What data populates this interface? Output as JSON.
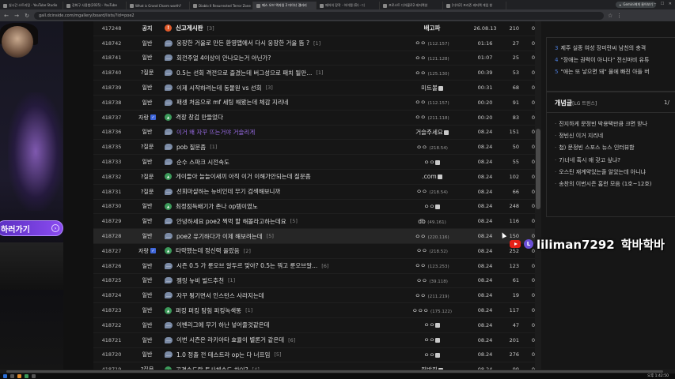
{
  "browser": {
    "tabs": [
      {
        "label": "실시간 스트리밍 - YouTube Studio",
        "active": false
      },
      {
        "label": "강화구 사용법(2025) - YouTube",
        "active": false
      },
      {
        "label": "What is Grand Charm worth?",
        "active": false
      },
      {
        "label": "Diablo II Resurrected Terror Zone",
        "active": false
      },
      {
        "label": "패스 오브 엑자일 2 마이너 갤러리",
        "active": true
      },
      {
        "label": "패어의 장작 - 아이템 (D) - 디",
        "active": false
      },
      {
        "label": "프로스트 디아블로2 레저렉션",
        "active": false
      },
      {
        "label": "[디아2] 프리즌 레저렉 게임 창",
        "active": false
      }
    ],
    "gemini_pill": "Gemini에게 물어보기",
    "url": "gall.dcinside.com/mgallery/board/lists/?id=poe2"
  },
  "poster": {
    "cta_label": "하러가기"
  },
  "posts": [
    {
      "no": "417248",
      "cat": "공지",
      "badge": false,
      "icon": "notice",
      "title": "신고게시판",
      "count": "[3]",
      "writer": "배고파",
      "ip": "",
      "wbadge": false,
      "date": "26.08.13",
      "views": "210",
      "rec": "0",
      "highlight": false,
      "bold": true
    },
    {
      "no": "418742",
      "cat": "일반",
      "badge": false,
      "icon": "bubble",
      "title": "웅장한 거울로 만든 환영맵에서 다시 웅장한 거울 뜸 ?",
      "count": "[1]",
      "writer": "ㅇㅇ",
      "ip": "(112.157)",
      "wbadge": false,
      "date": "01:16",
      "views": "27",
      "rec": "0",
      "highlight": false,
      "bold": false
    },
    {
      "no": "418741",
      "cat": "일반",
      "badge": false,
      "icon": "bubble",
      "title": "회전주얼 4이상이 안나오는거 아닌가?",
      "count": "",
      "writer": "ㅇㅇ",
      "ip": "(121.128)",
      "wbadge": false,
      "date": "01:07",
      "views": "25",
      "rec": "0",
      "highlight": false,
      "bold": false
    },
    {
      "no": "418740",
      "cat": "?질문",
      "badge": false,
      "icon": "bubble",
      "title": "0.5는 선회 격전으로 즐겼는데 버그성으로 패치 될만...",
      "count": "[1]",
      "writer": "ㅇㅇ",
      "ip": "(125.130)",
      "wbadge": false,
      "date": "00:39",
      "views": "53",
      "rec": "0",
      "highlight": false,
      "bold": false
    },
    {
      "no": "418739",
      "cat": "일반",
      "badge": false,
      "icon": "bubble",
      "title": "이제 시작하려는데 동물원 vs 선회",
      "count": "[3]",
      "writer": "미트볼",
      "ip": "",
      "wbadge": true,
      "date": "00:31",
      "views": "68",
      "rec": "0",
      "highlight": false,
      "bold": false
    },
    {
      "no": "418738",
      "cat": "일반",
      "badge": false,
      "icon": "bubble",
      "title": "패셍 처음으로 mf 세팅 해봤는데 체감 지리네",
      "count": "",
      "writer": "ㅇㅇ",
      "ip": "(112.157)",
      "wbadge": false,
      "date": "00:20",
      "views": "91",
      "rec": "0",
      "highlight": false,
      "bold": false
    },
    {
      "no": "418737",
      "cat": "자랑",
      "badge": true,
      "icon": "img",
      "title": "격장 창검 만들었다",
      "count": "",
      "writer": "ㅇㅇ",
      "ip": "(211.118)",
      "wbadge": false,
      "date": "00:20",
      "views": "83",
      "rec": "0",
      "highlight": false,
      "bold": false
    },
    {
      "no": "418736",
      "cat": "일반",
      "badge": false,
      "icon": "bubble",
      "title": "이거 왜 자꾸 뜨는거야 거슬리게",
      "count": "",
      "writer": "거슬주세요",
      "ip": "",
      "wbadge": true,
      "date": "08.24",
      "views": "151",
      "rec": "0",
      "highlight": false,
      "bold": false,
      "visited": true
    },
    {
      "no": "418735",
      "cat": "?질문",
      "badge": false,
      "icon": "bubble",
      "title": "pob 질문좀",
      "count": "[1]",
      "writer": "ㅇㅇ",
      "ip": "(218.54)",
      "wbadge": false,
      "date": "08.24",
      "views": "50",
      "rec": "0",
      "highlight": false,
      "bold": false
    },
    {
      "no": "418733",
      "cat": "일반",
      "badge": false,
      "icon": "bubble",
      "title": "순수 스파크 시전속도",
      "count": "",
      "writer": "ㅇㅇ",
      "ip": "",
      "wbadge": true,
      "date": "08.24",
      "views": "55",
      "rec": "0",
      "highlight": false,
      "bold": false
    },
    {
      "no": "418732",
      "cat": "?질문",
      "badge": false,
      "icon": "img",
      "title": "게이들아 늘늘이새끼 아직 이거 이해가안되는데 질문좀",
      "count": "",
      "writer": ".com",
      "ip": "",
      "wbadge": true,
      "date": "08.24",
      "views": "102",
      "rec": "0",
      "highlight": false,
      "bold": false
    },
    {
      "no": "418731",
      "cat": "?질문",
      "badge": false,
      "icon": "bubble",
      "title": "선회마샬하는 뉴비인데 무기 검색해보니까",
      "count": "",
      "writer": "ㅇㅇ",
      "ip": "(218.54)",
      "wbadge": false,
      "date": "08.24",
      "views": "66",
      "rec": "0",
      "highlight": false,
      "bold": false
    },
    {
      "no": "418730",
      "cat": "일반",
      "badge": false,
      "icon": "img",
      "title": "최정점득배기가 존나 op템이였노",
      "count": "",
      "writer": "ㅇㅇ",
      "ip": "",
      "wbadge": true,
      "date": "08.24",
      "views": "248",
      "rec": "0",
      "highlight": false,
      "bold": false
    },
    {
      "no": "418729",
      "cat": "일반",
      "badge": false,
      "icon": "bubble",
      "title": "안녕하세요 poe2 찍먹 할 해볼라고하는데요",
      "count": "[5]",
      "writer": "db",
      "ip": "(49.161)",
      "wbadge": false,
      "date": "08.24",
      "views": "116",
      "rec": "0",
      "highlight": false,
      "bold": false
    },
    {
      "no": "418728",
      "cat": "일반",
      "badge": false,
      "icon": "bubble",
      "title": "poe2 유기하다가 이제 해보려는데",
      "count": "[5]",
      "writer": "ㅇㅇ",
      "ip": "(220.116)",
      "wbadge": false,
      "date": "08.24",
      "views": "150",
      "rec": "0",
      "highlight": true,
      "bold": false
    },
    {
      "no": "418727",
      "cat": "자랑",
      "badge": true,
      "icon": "img",
      "title": "타락했는데 정신력 올랐음",
      "count": "[2]",
      "writer": "ㅇㅇ",
      "ip": "(218.52)",
      "wbadge": false,
      "date": "08.24",
      "views": "252",
      "rec": "0",
      "highlight": false,
      "bold": false
    },
    {
      "no": "418726",
      "cat": "일반",
      "badge": false,
      "icon": "bubble",
      "title": "시즌 0.5 가 룬오브 알두르 맞아? 0.5는 뭐고 룬오브알...",
      "count": "[6]",
      "writer": "ㅇㅇ",
      "ip": "(123.253)",
      "wbadge": false,
      "date": "08.24",
      "views": "123",
      "rec": "0",
      "highlight": false,
      "bold": false
    },
    {
      "no": "418725",
      "cat": "일반",
      "badge": false,
      "icon": "bubble",
      "title": "젬링 뉴비 빌드추천",
      "count": "[1]",
      "writer": "ㅇㅇ",
      "ip": "(39.118)",
      "wbadge": false,
      "date": "08.24",
      "views": "61",
      "rec": "0",
      "highlight": false,
      "bold": false
    },
    {
      "no": "418724",
      "cat": "일반",
      "badge": false,
      "icon": "bubble",
      "title": "자꾸 튕기면서 인스턴스 사라지는데",
      "count": "",
      "writer": "ㅇㅇ",
      "ip": "(211.219)",
      "wbadge": false,
      "date": "08.24",
      "views": "19",
      "rec": "0",
      "highlight": false,
      "bold": false
    },
    {
      "no": "418723",
      "cat": "일반",
      "badge": false,
      "icon": "img",
      "title": "퍼킹 퍼킹 탐험 퍼킹녹색똥",
      "count": "[1]",
      "writer": "ㅇㅇㅇ",
      "ip": "(175.122)",
      "wbadge": false,
      "date": "08.24",
      "views": "117",
      "rec": "0",
      "highlight": false,
      "bold": false
    },
    {
      "no": "418722",
      "cat": "일반",
      "badge": false,
      "icon": "bubble",
      "title": "이벤리그에 무기 하난 넣어줄것같은데",
      "count": "",
      "writer": "ㅇㅇ",
      "ip": "",
      "wbadge": true,
      "date": "08.24",
      "views": "47",
      "rec": "0",
      "highlight": false,
      "bold": false
    },
    {
      "no": "418721",
      "cat": "일반",
      "badge": false,
      "icon": "bubble",
      "title": "이번 시즌은 라키아타 효율이 별론거 같은데",
      "count": "[6]",
      "writer": "ㅇㅇ",
      "ip": "",
      "wbadge": true,
      "date": "08.24",
      "views": "201",
      "rec": "0",
      "highlight": false,
      "bold": false
    },
    {
      "no": "418720",
      "cat": "일반",
      "badge": false,
      "icon": "bubble",
      "title": "1.0 정출 전 테스트라 op는 다 너프임",
      "count": "[5]",
      "writer": "ㅇㅇ",
      "ip": "",
      "wbadge": true,
      "date": "08.24",
      "views": "276",
      "rec": "0",
      "highlight": false,
      "bold": false
    },
    {
      "no": "418719",
      "cat": "?질문",
      "badge": false,
      "icon": "img",
      "title": "공격속도랑 투사체속도 차이?",
      "count": "[4]",
      "writer": "쥐방쥐",
      "ip": "",
      "wbadge": true,
      "date": "08.24",
      "views": "99",
      "rec": "0",
      "highlight": false,
      "bold": false
    }
  ],
  "sidebar": {
    "ranking": [
      {
        "n": "3",
        "text": "제주 실종 여성 장미란씨 남친의 충격"
      },
      {
        "n": "4",
        "text": "\"장애는 권력이 아니다\" 전신마비 유튜"
      },
      {
        "n": "5",
        "text": "\"애는 또 낳으면 돼\" 물에 빠진 아들 버"
      }
    ],
    "news_title": "개념글",
    "news_sub": "[LG 트윈스]",
    "news_page": "1/",
    "news": [
      "진지하게 문정빈 박용택만큼 크면 받나",
      "정빈신 이거 지리네",
      "첩) 문정빈 스포스 뉴스 인터뷰함",
      "7)너네 혹시 애 갖고 싶냐?",
      "오스틴 재계약있는줄 알았는데 아니냐",
      "송찬의 이번시즌 홈런 모음 (1호~12호)"
    ]
  },
  "overlay": {
    "channel": "liliman7292",
    "channel_kor": "학바학바",
    "badge_letter": "L"
  },
  "taskbar": {
    "clock": "오후 1:42:50"
  }
}
